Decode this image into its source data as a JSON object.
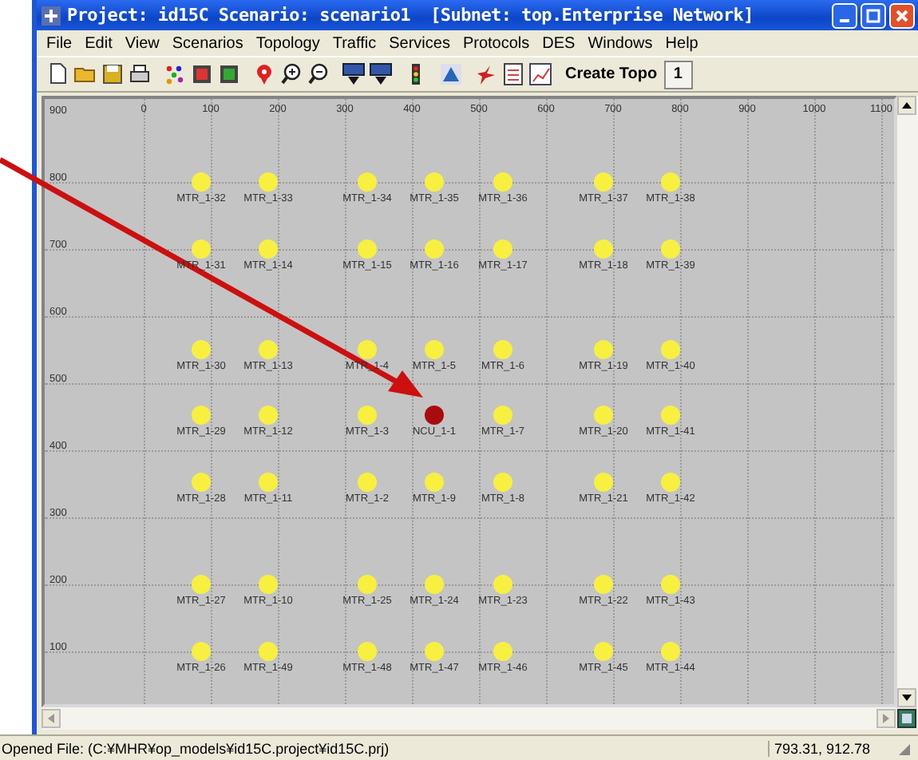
{
  "window": {
    "title": "Project: id15C Scenario: scenario1  [Subnet: top.Enterprise Network]"
  },
  "menu": [
    "File",
    "Edit",
    "View",
    "Scenarios",
    "Topology",
    "Traffic",
    "Services",
    "Protocols",
    "DES",
    "Windows",
    "Help"
  ],
  "toolbar": {
    "create_button": "Create Topo",
    "number_button": "1"
  },
  "canvas": {
    "x_ticks": [
      "0",
      "100",
      "200",
      "300",
      "400",
      "500",
      "600",
      "700",
      "800",
      "900",
      "1000",
      "1100"
    ],
    "y_ticks": [
      "900",
      "800",
      "700",
      "600",
      "500",
      "400",
      "300",
      "200",
      "100"
    ],
    "node_rows": [
      [
        {
          "label": "MTR_1-32",
          "kind": "mtr"
        },
        {
          "label": "MTR_1-33",
          "kind": "mtr"
        },
        {
          "label": "MTR_1-34",
          "kind": "mtr"
        },
        {
          "label": "MTR_1-35",
          "kind": "mtr"
        },
        {
          "label": "MTR_1-36",
          "kind": "mtr"
        },
        {
          "label": "MTR_1-37",
          "kind": "mtr"
        },
        {
          "label": "MTR_1-38",
          "kind": "mtr"
        }
      ],
      [
        {
          "label": "MTR_1-31",
          "kind": "mtr"
        },
        {
          "label": "MTR_1-14",
          "kind": "mtr"
        },
        {
          "label": "MTR_1-15",
          "kind": "mtr"
        },
        {
          "label": "MTR_1-16",
          "kind": "mtr"
        },
        {
          "label": "MTR_1-17",
          "kind": "mtr"
        },
        {
          "label": "MTR_1-18",
          "kind": "mtr"
        },
        {
          "label": "MTR_1-39",
          "kind": "mtr"
        }
      ],
      [
        {
          "label": "MTR_1-30",
          "kind": "mtr"
        },
        {
          "label": "MTR_1-13",
          "kind": "mtr"
        },
        {
          "label": "MTR_1-4",
          "kind": "mtr"
        },
        {
          "label": "MTR_1-5",
          "kind": "mtr"
        },
        {
          "label": "MTR_1-6",
          "kind": "mtr"
        },
        {
          "label": "MTR_1-19",
          "kind": "mtr"
        },
        {
          "label": "MTR_1-40",
          "kind": "mtr"
        }
      ],
      [
        {
          "label": "MTR_1-29",
          "kind": "mtr"
        },
        {
          "label": "MTR_1-12",
          "kind": "mtr"
        },
        {
          "label": "MTR_1-3",
          "kind": "mtr"
        },
        {
          "label": "NCU_1-1",
          "kind": "ncu"
        },
        {
          "label": "MTR_1-7",
          "kind": "mtr"
        },
        {
          "label": "MTR_1-20",
          "kind": "mtr"
        },
        {
          "label": "MTR_1-41",
          "kind": "mtr"
        }
      ],
      [
        {
          "label": "MTR_1-28",
          "kind": "mtr"
        },
        {
          "label": "MTR_1-11",
          "kind": "mtr"
        },
        {
          "label": "MTR_1-2",
          "kind": "mtr"
        },
        {
          "label": "MTR_1-9",
          "kind": "mtr"
        },
        {
          "label": "MTR_1-8",
          "kind": "mtr"
        },
        {
          "label": "MTR_1-21",
          "kind": "mtr"
        },
        {
          "label": "MTR_1-42",
          "kind": "mtr"
        }
      ],
      [
        {
          "label": "MTR_1-27",
          "kind": "mtr"
        },
        {
          "label": "MTR_1-10",
          "kind": "mtr"
        },
        {
          "label": "MTR_1-25",
          "kind": "mtr"
        },
        {
          "label": "MTR_1-24",
          "kind": "mtr"
        },
        {
          "label": "MTR_1-23",
          "kind": "mtr"
        },
        {
          "label": "MTR_1-22",
          "kind": "mtr"
        },
        {
          "label": "MTR_1-43",
          "kind": "mtr"
        }
      ],
      [
        {
          "label": "MTR_1-26",
          "kind": "mtr"
        },
        {
          "label": "MTR_1-49",
          "kind": "mtr"
        },
        {
          "label": "MTR_1-48",
          "kind": "mtr"
        },
        {
          "label": "MTR_1-47",
          "kind": "mtr"
        },
        {
          "label": "MTR_1-46",
          "kind": "mtr"
        },
        {
          "label": "MTR_1-45",
          "kind": "mtr"
        },
        {
          "label": "MTR_1-44",
          "kind": "mtr"
        }
      ]
    ]
  },
  "status_bar": {
    "message": "Opened File: (C:¥MHR¥op_models¥id15C.project¥id15C.prj)",
    "coordinates": "793.31, 912.78"
  }
}
